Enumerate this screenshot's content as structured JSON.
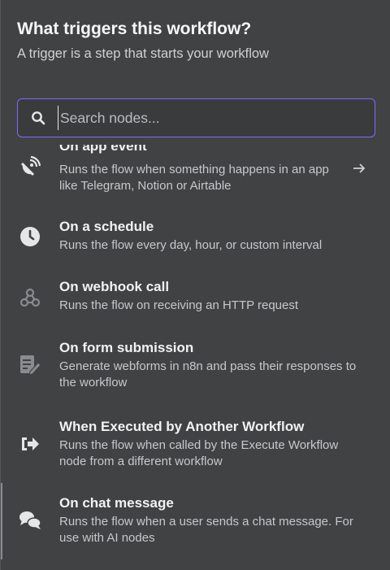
{
  "header": {
    "title": "What triggers this workflow?",
    "subtitle": "A trigger is a step that starts your workflow"
  },
  "search": {
    "placeholder": "Search nodes...",
    "value": ""
  },
  "triggers": [
    {
      "name": "On app event",
      "description": "Runs the flow when something happens in an app like Telegram, Notion or Airtable",
      "icon": "satellite-dish-icon",
      "has_arrow": true
    },
    {
      "name": "On a schedule",
      "description": "Runs the flow every day, hour, or custom interval",
      "icon": "clock-icon"
    },
    {
      "name": "On webhook call",
      "description": "Runs the flow on receiving an HTTP request",
      "icon": "webhook-icon"
    },
    {
      "name": "On form submission",
      "description": "Generate webforms in n8n and pass their responses to the workflow",
      "icon": "form-pen-icon"
    },
    {
      "name": "When Executed by Another Workflow",
      "description": "Runs the flow when called by the Execute Workflow node from a different workflow",
      "icon": "sign-in-icon"
    },
    {
      "name": "On chat message",
      "description": "Runs the flow when a user sends a chat message. For use with AI nodes",
      "icon": "chat-bubbles-icon"
    }
  ],
  "colors": {
    "background": "#414244",
    "search_border": "#7a6cff",
    "title": "#f7f7f7",
    "description": "#c8c8cc"
  }
}
